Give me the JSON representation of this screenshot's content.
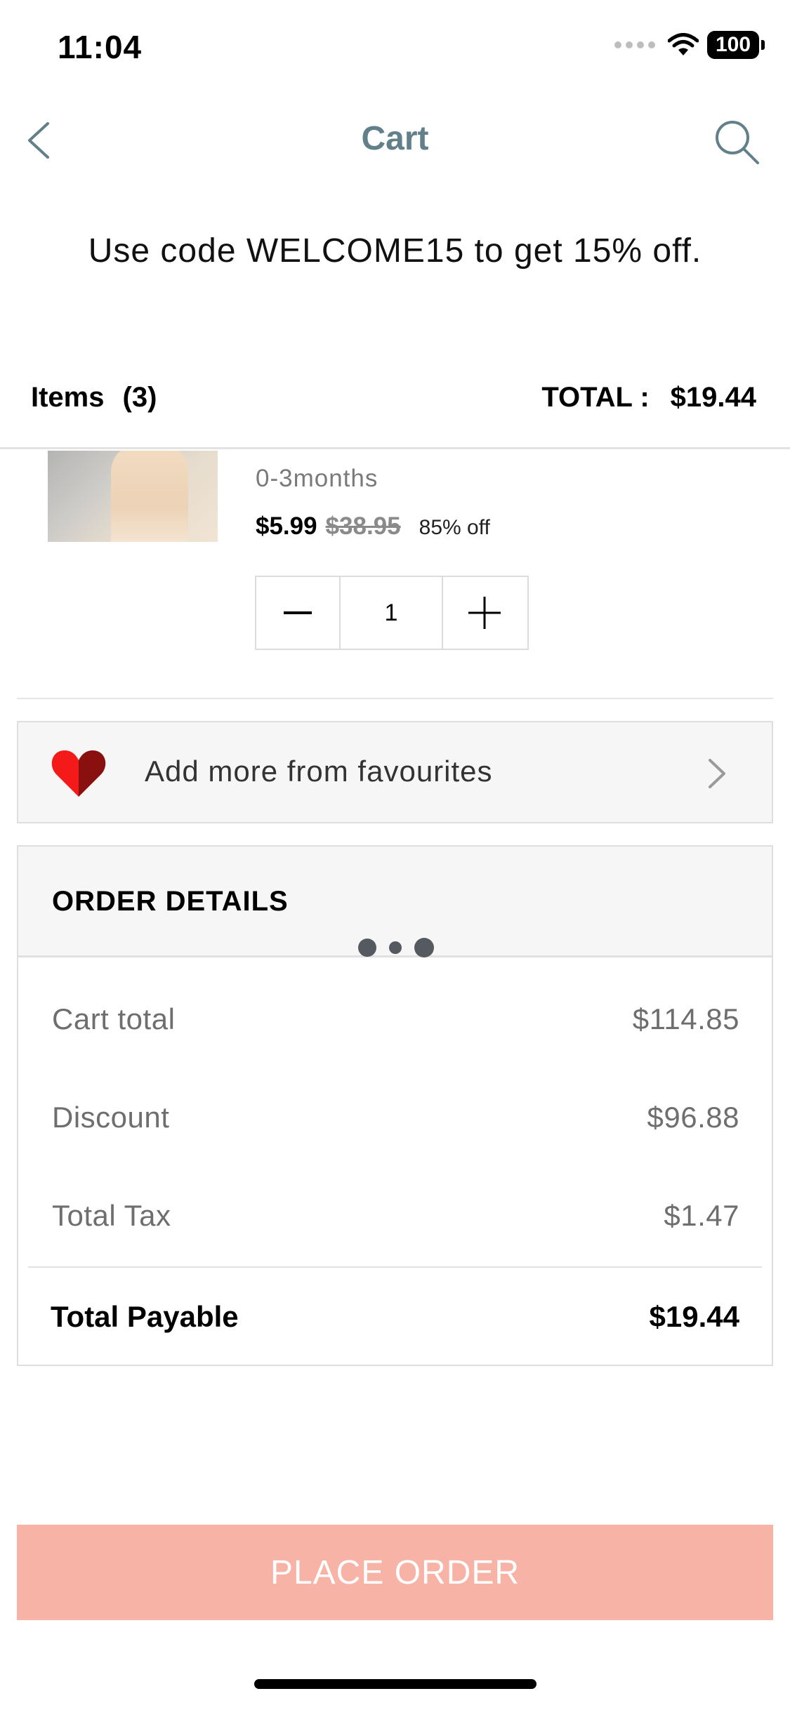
{
  "status_bar": {
    "time": "11:04",
    "battery": "100"
  },
  "nav": {
    "title": "Cart"
  },
  "promo": {
    "text": "Use code WELCOME15 to get 15% off."
  },
  "summary": {
    "items_label": "Items",
    "items_count": "(3)",
    "total_label": "TOTAL :",
    "total_value": "$19.44"
  },
  "product": {
    "size": "0-3months",
    "price": "$5.99",
    "original_price": "$38.95",
    "discount": "85% off",
    "quantity": "1"
  },
  "favourites": {
    "label": "Add more from favourites"
  },
  "order_details": {
    "title": "ORDER DETAILS",
    "rows": [
      {
        "label": "Cart total",
        "value": "$114.85"
      },
      {
        "label": "Discount",
        "value": "$96.88"
      },
      {
        "label": "Total Tax",
        "value": "$1.47"
      }
    ],
    "payable_label": "Total Payable",
    "payable_value": "$19.44"
  },
  "place_order": {
    "label": "PLACE ORDER"
  },
  "colors": {
    "accent": "#62808a",
    "cta": "#f8b3a7",
    "heart_left": "#f41a1a",
    "heart_right": "#8a0f0f"
  },
  "icons": [
    "back-chevron",
    "search",
    "minus",
    "plus",
    "heart",
    "chevron-right",
    "wifi"
  ]
}
